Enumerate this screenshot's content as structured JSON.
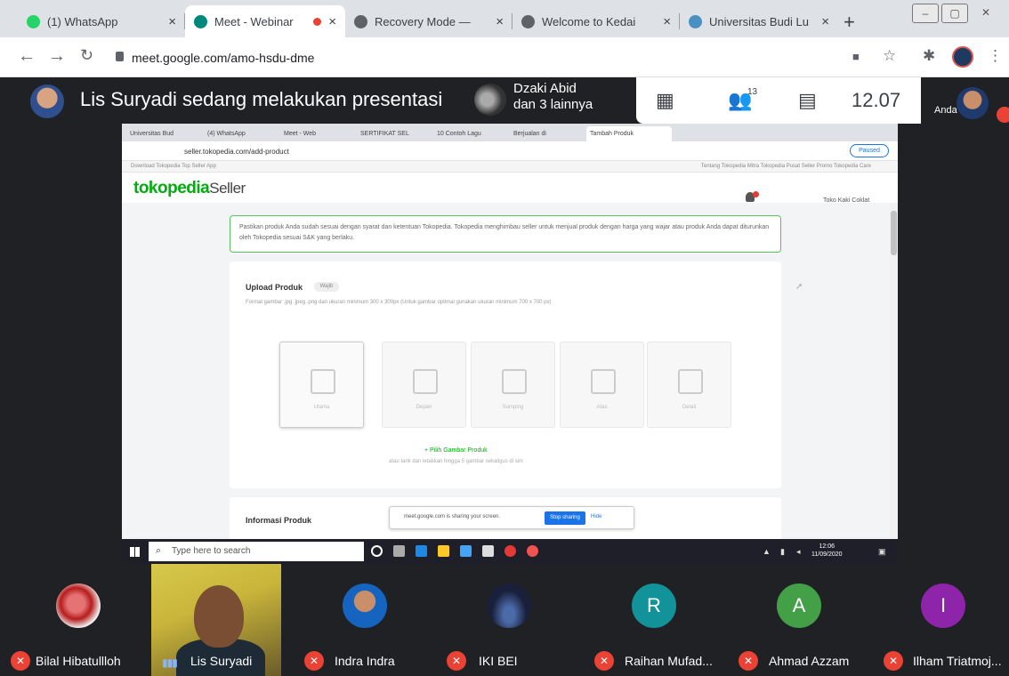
{
  "browser": {
    "tabs": [
      {
        "title": "(1) WhatsApp",
        "favicon_color": "#25d366"
      },
      {
        "title": "Meet - Webinar",
        "favicon_color": "#00897b",
        "recording": true
      },
      {
        "title": "Recovery Mode — ",
        "favicon_color": "#5f6368"
      },
      {
        "title": "Welcome to Kedai",
        "favicon_color": "#5f6368"
      },
      {
        "title": "Universitas Budi Lu",
        "favicon_color": "#4a90c2"
      }
    ],
    "new_tab": "+",
    "close": "×",
    "url": "meet.google.com/amo-hsdu-dme",
    "win_controls": [
      "–",
      "▢",
      "✕"
    ]
  },
  "meet": {
    "presenting_text": "Lis Suryadi sedang melakukan presentasi",
    "pinned_name": "Dzaki Abid",
    "pinned_sub": "dan 3 lainnya",
    "participants_count": "13",
    "time": "12.07",
    "self_label": "Anda"
  },
  "shared_screen": {
    "tabs": [
      "Universitas Bud",
      "(4) WhatsApp",
      "Meet - Web",
      "SERTIFIKAT SEL",
      "10 Contoh Lagu",
      "Berjualan di",
      "Tambah Produk"
    ],
    "url": "seller.tokopedia.com/add-product",
    "paused": "Paused",
    "topbar_left": "Download Tokopedia Top Seller App",
    "topbar_right": "Tentang Tokopedia   Mitra Tokopedia   Pusat Seller   Promo   Tokopedia Care",
    "logo_main": "tokopedia",
    "logo_sub": "Seller",
    "header_right": "Toko Kaki Coklat",
    "notice": "Pastikan produk Anda sudah sesuai dengan syarat dan ketentuan Tokopedia. Tokopedia menghimbau seller untuk menjual produk dengan harga yang wajar atau produk Anda dapat diturunkan oleh Tokopedia sesuai S&K yang berlaku.",
    "upload_title": "Upload Produk",
    "upload_badge": "Wajib",
    "upload_sub": "Format gambar .jpg .jpeg .png dan ukuran minimum 300 x 300px (Untuk gambar optimal gunakan ukuran minimum 700 x 700 px)",
    "slots": [
      "Utama",
      "Depan",
      "Samping",
      "Atas",
      "Detail"
    ],
    "pick_link": "+ Pilih Gambar Produk",
    "pick_sub": "atau tarik dan letakkan hingga 5 gambar sekaligus di sini",
    "info_title": "Informasi Produk",
    "share_text": "meet.google.com is sharing your screen.",
    "share_stop": "Stop sharing",
    "share_hide": "Hide",
    "taskbar_search": "Type here to search",
    "taskbar_time": "12:06",
    "taskbar_date": "11/09/2020"
  },
  "participants": [
    {
      "name": "Bilal Hibatullloh",
      "muted": true,
      "avatar_color": "#b71c1c"
    },
    {
      "name": "Lis Suryadi",
      "muted": false,
      "speaking": true
    },
    {
      "name": "Indra Indra",
      "muted": true,
      "avatar_color": "#1565c0"
    },
    {
      "name": "IKI BEI",
      "muted": true,
      "avatar_color": "#1a1f3a"
    },
    {
      "name": "Raihan Mufad...",
      "muted": true,
      "initial": "R",
      "avatar_color": "#12939a"
    },
    {
      "name": "Ahmad Azzam",
      "muted": true,
      "initial": "A",
      "avatar_color": "#43a047"
    },
    {
      "name": "Ilham Triatmoj...",
      "muted": true,
      "initial": "I",
      "avatar_color": "#8e24aa"
    }
  ]
}
